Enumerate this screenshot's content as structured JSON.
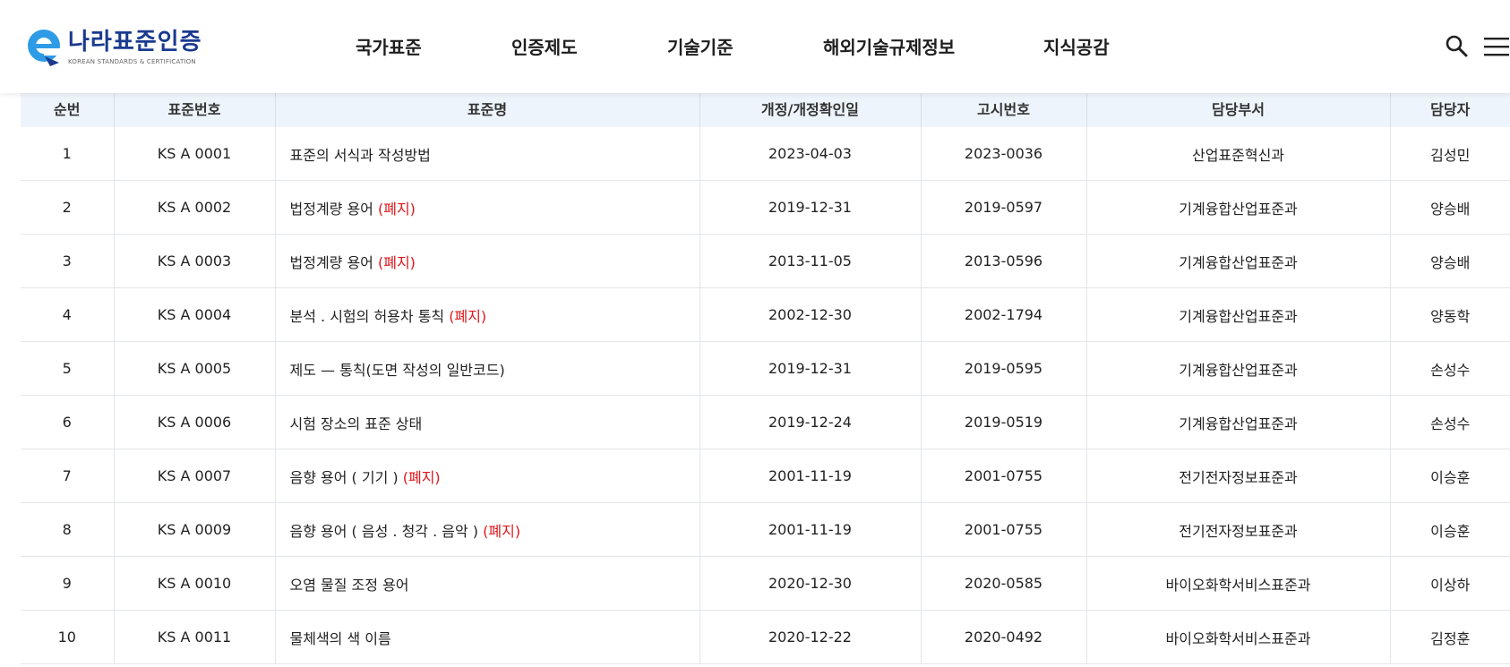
{
  "header": {
    "logo_title": "나라표준인증",
    "logo_subtitle": "KOREAN STANDARDS & CERTIFICATION",
    "brand_color": "#1a3a8f",
    "accent_color": "#2e9be6",
    "search_icon": "search-icon",
    "menu_icon": "hamburger-menu-icon"
  },
  "nav": {
    "items": [
      {
        "label": "국가표준"
      },
      {
        "label": "인증제도"
      },
      {
        "label": "기술기준"
      },
      {
        "label": "해외기술규제정보"
      },
      {
        "label": "지식공감"
      }
    ]
  },
  "table": {
    "columns": [
      "순번",
      "표준번호",
      "표준명",
      "개정/개정확인일",
      "고시번호",
      "담당부서",
      "담당자"
    ],
    "abolished_color": "#e0161a",
    "rows": [
      {
        "no": "1",
        "code": "KS A 0001",
        "name": "표준의 서식과 작성방법",
        "tag": "",
        "date": "2023-04-03",
        "notice": "2023-0036",
        "dept": "산업표준혁신과",
        "person": "김성민"
      },
      {
        "no": "2",
        "code": "KS A 0002",
        "name": "법정계량 용어",
        "tag": "(폐지)",
        "date": "2019-12-31",
        "notice": "2019-0597",
        "dept": "기계융합산업표준과",
        "person": "양승배"
      },
      {
        "no": "3",
        "code": "KS A 0003",
        "name": "법정계량 용어",
        "tag": "(폐지)",
        "date": "2013-11-05",
        "notice": "2013-0596",
        "dept": "기계융합산업표준과",
        "person": "양승배"
      },
      {
        "no": "4",
        "code": "KS A 0004",
        "name": "분석 . 시험의 허용차 통칙",
        "tag": "(폐지)",
        "date": "2002-12-30",
        "notice": "2002-1794",
        "dept": "기계융합산업표준과",
        "person": "양동학"
      },
      {
        "no": "5",
        "code": "KS A 0005",
        "name": "제도 — 통칙(도면 작성의 일반코드)",
        "tag": "",
        "date": "2019-12-31",
        "notice": "2019-0595",
        "dept": "기계융합산업표준과",
        "person": "손성수"
      },
      {
        "no": "6",
        "code": "KS A 0006",
        "name": "시험 장소의 표준 상태",
        "tag": "",
        "date": "2019-12-24",
        "notice": "2019-0519",
        "dept": "기계융합산업표준과",
        "person": "손성수"
      },
      {
        "no": "7",
        "code": "KS A 0007",
        "name": "음향 용어 ( 기기 )",
        "tag": "(폐지)",
        "date": "2001-11-19",
        "notice": "2001-0755",
        "dept": "전기전자정보표준과",
        "person": "이승훈"
      },
      {
        "no": "8",
        "code": "KS A 0009",
        "name": "음향 용어 ( 음성 . 청각 . 음악 )",
        "tag": "(폐지)",
        "date": "2001-11-19",
        "notice": "2001-0755",
        "dept": "전기전자정보표준과",
        "person": "이승훈"
      },
      {
        "no": "9",
        "code": "KS A 0010",
        "name": "오염 물질 조정 용어",
        "tag": "",
        "date": "2020-12-30",
        "notice": "2020-0585",
        "dept": "바이오화학서비스표준과",
        "person": "이상하"
      },
      {
        "no": "10",
        "code": "KS A 0011",
        "name": "물체색의 색 이름",
        "tag": "",
        "date": "2020-12-22",
        "notice": "2020-0492",
        "dept": "바이오화학서비스표준과",
        "person": "김정훈"
      }
    ]
  }
}
